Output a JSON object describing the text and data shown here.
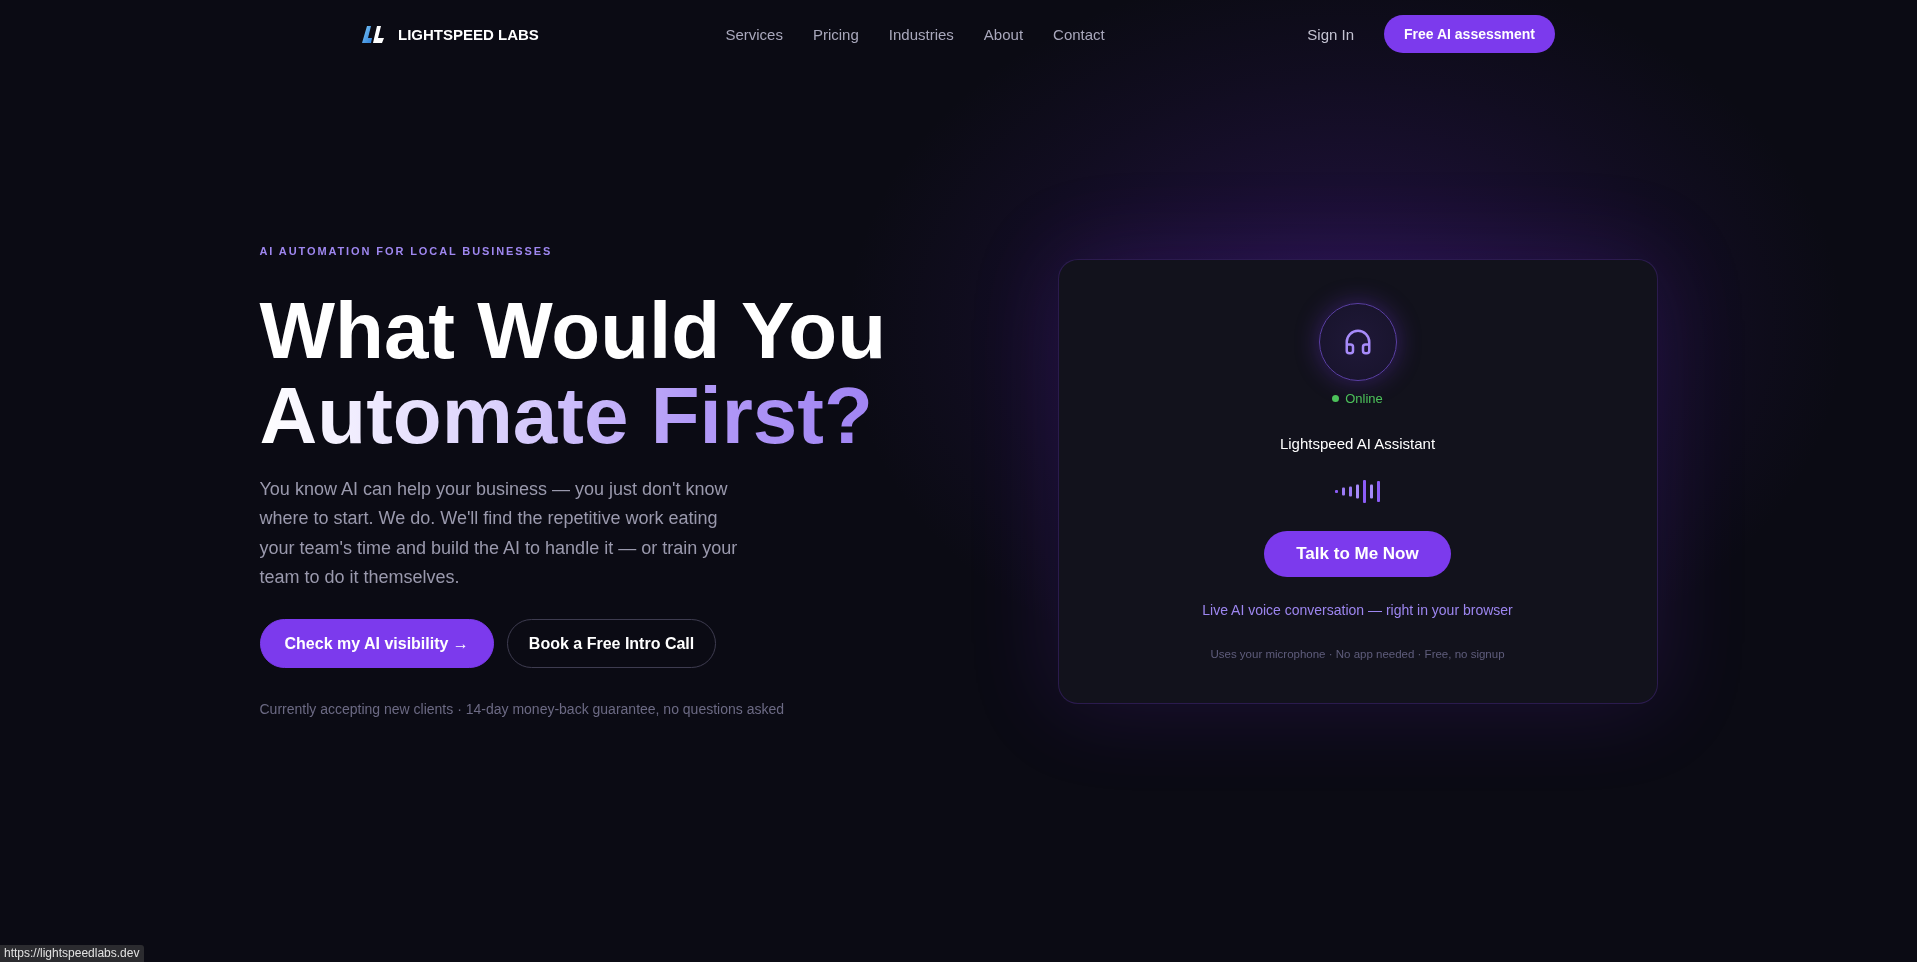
{
  "nav": {
    "brand": "LIGHTSPEED LABS",
    "links": [
      "Services",
      "Pricing",
      "Industries",
      "About",
      "Contact"
    ],
    "sign_in": "Sign In",
    "cta": "Free AI assessment"
  },
  "hero": {
    "eyebrow": "AI AUTOMATION FOR LOCAL BUSINESSES",
    "headline": {
      "lead": "What Would You",
      "highlight": "Automate First?"
    },
    "body": "You know AI can help your business — you just don't know where to start. We do. We'll find the repetitive work eating your team's time and build the AI to handle it — or train your team to do it themselves.",
    "buttons": [
      {
        "label": "Check my AI visibility →",
        "kind": "primary"
      },
      {
        "label": "Book a Free Intro Call",
        "kind": "outline"
      }
    ],
    "note": "Currently accepting new clients · 14-day money-back guarantee, no questions asked"
  },
  "assistant_card": {
    "online": true,
    "status": "Online",
    "title": "Lightspeed AI Assistant",
    "button": "Talk to Me Now",
    "caption": "Live AI voice conversation — right in your browser",
    "fine_print": "Uses your microphone · No app needed · Free, no signup"
  },
  "status_bubble": {
    "url": "https://lightspeedlabs.dev"
  }
}
